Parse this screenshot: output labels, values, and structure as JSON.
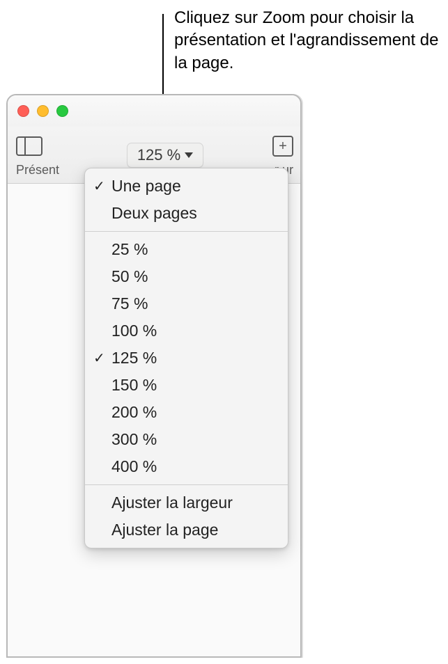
{
  "callout": {
    "text": "Cliquez sur Zoom pour choisir la présentation et l'agrandissement de la page."
  },
  "toolbar": {
    "presentation_label": "Présent",
    "zoom_current": "125 %",
    "insert_label": "r ur"
  },
  "zoom_menu": {
    "view_options": [
      {
        "label": "Une page",
        "checked": true
      },
      {
        "label": "Deux pages",
        "checked": false
      }
    ],
    "zoom_levels": [
      {
        "label": "25 %",
        "checked": false
      },
      {
        "label": "50 %",
        "checked": false
      },
      {
        "label": "75 %",
        "checked": false
      },
      {
        "label": "100 %",
        "checked": false
      },
      {
        "label": "125 %",
        "checked": true
      },
      {
        "label": "150 %",
        "checked": false
      },
      {
        "label": "200 %",
        "checked": false
      },
      {
        "label": "300 %",
        "checked": false
      },
      {
        "label": "400 %",
        "checked": false
      }
    ],
    "fit_options": [
      {
        "label": "Ajuster la largeur"
      },
      {
        "label": "Ajuster la page"
      }
    ]
  }
}
